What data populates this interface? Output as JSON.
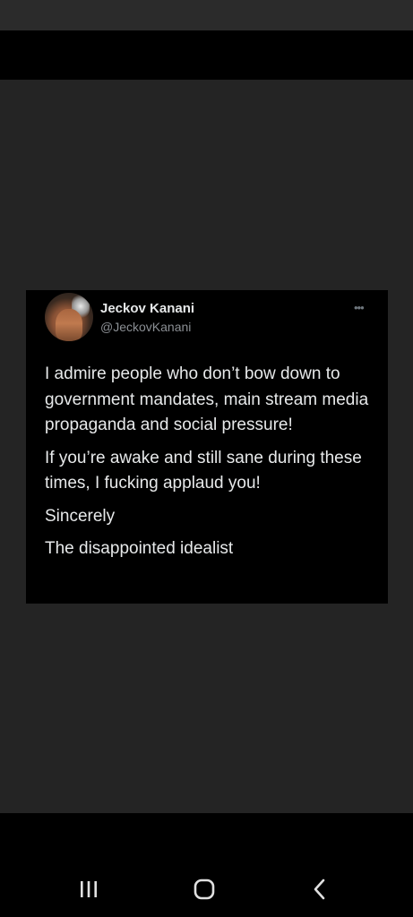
{
  "tweet": {
    "display_name": "Jeckov Kanani",
    "handle": "@JeckovKanani",
    "more_icon": "more-dots-icon",
    "paragraphs": [
      "I admire people who don’t bow down to government mandates, main stream media propaganda and social pressure!",
      "If you’re awake and still sane during these times, I fucking applaud you!",
      "Sincerely",
      "The disappointed idealist"
    ]
  },
  "nav": {
    "recent_apps_icon": "recent-apps-icon",
    "home_icon": "home-icon",
    "back_icon": "back-icon"
  },
  "colors": {
    "viewer_background": "#242424",
    "card_background": "#000000",
    "text": "#e7e9ea",
    "handle_text": "#8b8f94"
  }
}
